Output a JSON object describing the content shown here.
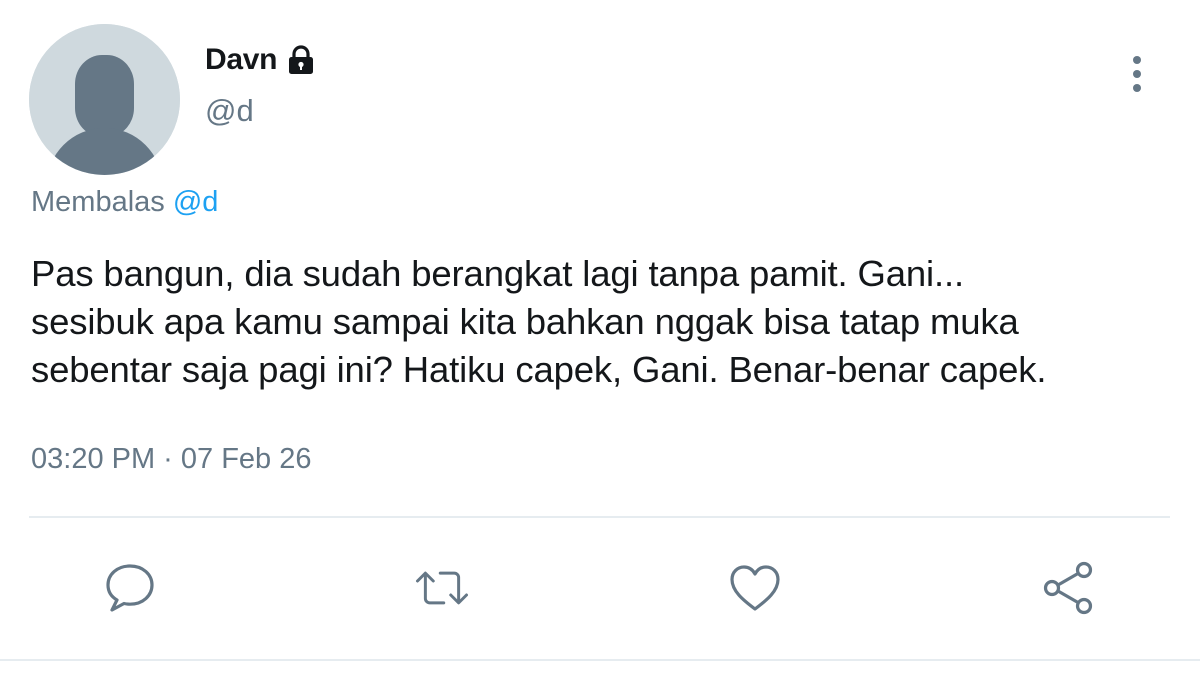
{
  "tweet": {
    "author": {
      "display_name": "Davn",
      "handle": "@d",
      "avatar_icon": "default-avatar-icon",
      "protected_icon": "lock-icon"
    },
    "reply": {
      "prefix": "Membalas",
      "handle": "@d"
    },
    "text": "Pas bangun, dia sudah berangkat lagi tanpa pamit. Gani...\nsesibuk apa kamu sampai kita bahkan nggak bisa tatap muka\nsebentar saja pagi ini? Hatiku capek, Gani. Benar-benar capek.",
    "timestamp": "03:20 PM · 07 Feb 26"
  },
  "actions": [
    {
      "name": "reply",
      "icon": "comment-icon"
    },
    {
      "name": "retweet",
      "icon": "retweet-icon"
    },
    {
      "name": "like",
      "icon": "heart-icon"
    },
    {
      "name": "share",
      "icon": "share-icon"
    }
  ],
  "menu_icon": "more-vertical-icon",
  "colors": {
    "text": "#14171a",
    "secondary": "#657786",
    "link": "#1da1f2",
    "avatar_bg": "#cfd9de",
    "avatar_fg": "#657786",
    "divider": "#e6ecf0"
  }
}
